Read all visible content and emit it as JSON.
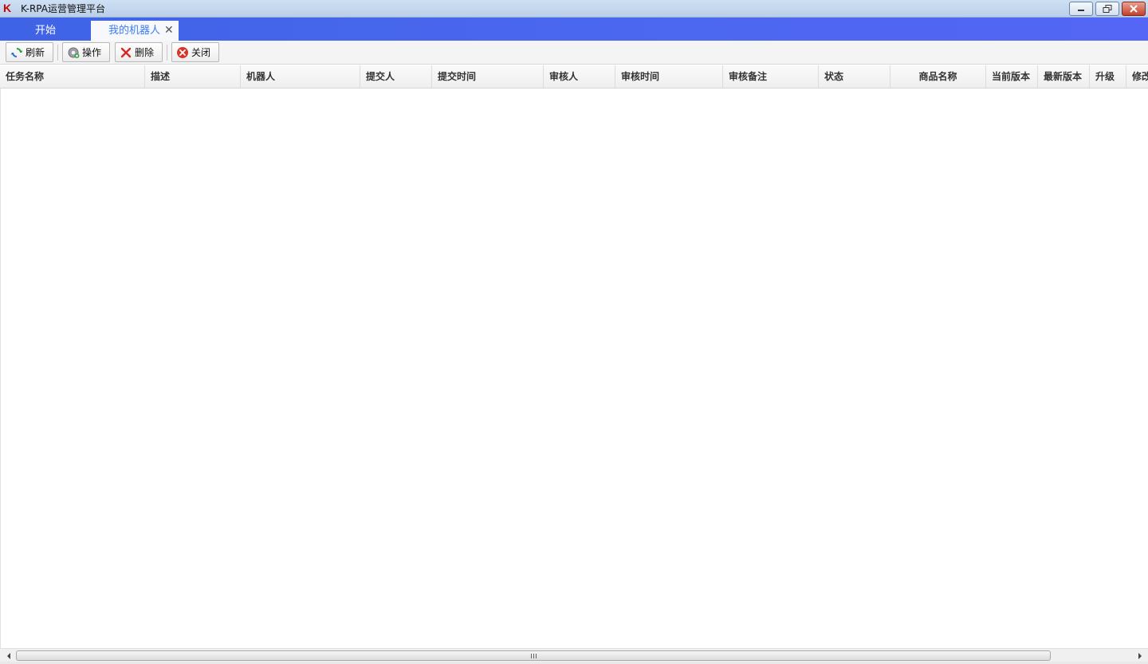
{
  "window": {
    "logo_letter": "K",
    "title": "K-RPA运营管理平台"
  },
  "tabs": [
    {
      "label": "开始",
      "active": false
    },
    {
      "label": "我的机器人",
      "active": true,
      "close_glyph": "✕"
    }
  ],
  "toolbar": {
    "refresh_label": "刷新",
    "operate_label": "操作",
    "delete_label": "删除",
    "close_label": "关闭"
  },
  "table": {
    "columns": [
      "任务名称",
      "描述",
      "机器人",
      "提交人",
      "提交时间",
      "审核人",
      "审核时间",
      "审核备注",
      "状态",
      "商品名称",
      "当前版本",
      "最新版本",
      "升级",
      "修改"
    ],
    "rows": []
  },
  "colors": {
    "tabbar_start": "#3f63e6",
    "tabbar_end": "#5466f5",
    "active_tab_text": "#3d7cf0",
    "logo": "#d00000"
  },
  "icons": {
    "refresh": "refresh-icon",
    "operate": "gear-icon",
    "delete": "delete-x-icon",
    "close": "close-circle-icon"
  }
}
